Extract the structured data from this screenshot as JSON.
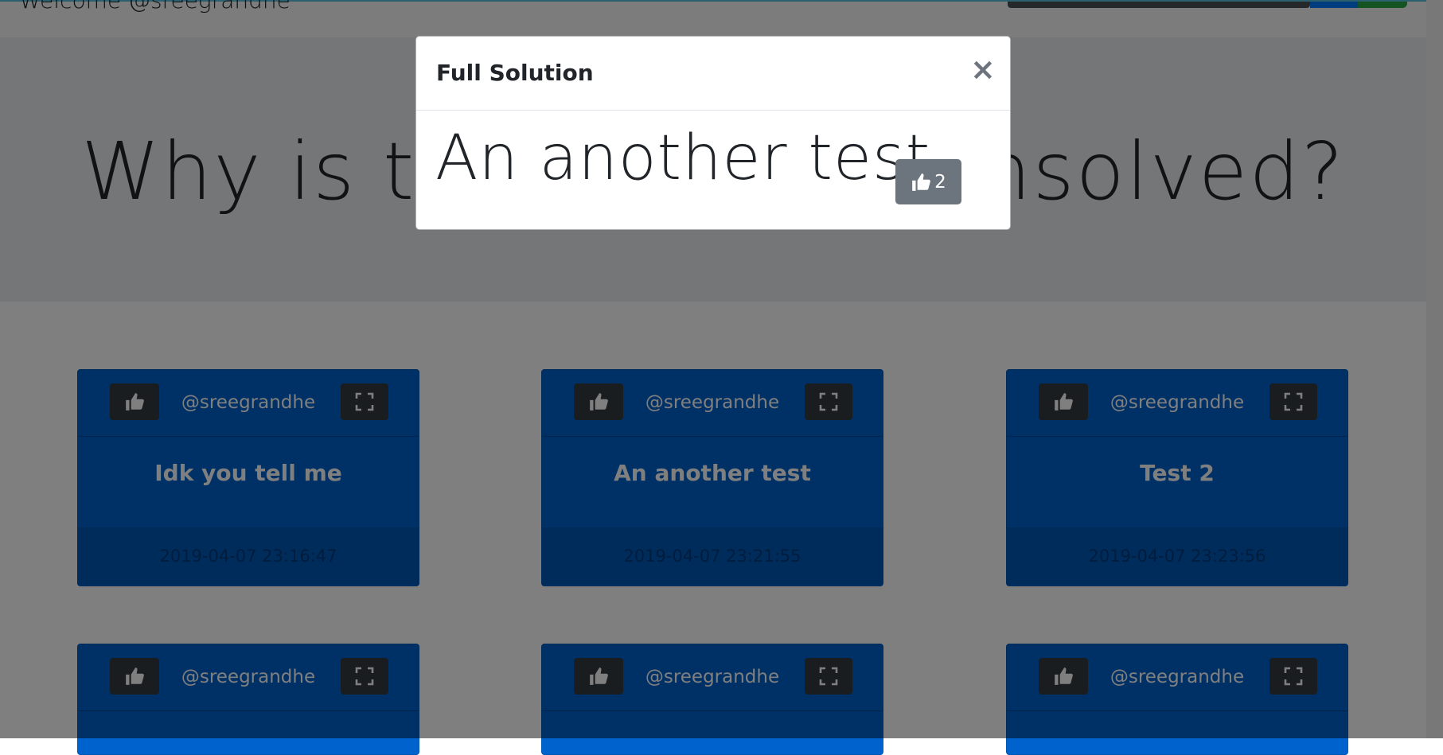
{
  "nav": {
    "welcome": "Welcome @sreegrandhe"
  },
  "question": {
    "text": "Why is this problem unsolved?"
  },
  "cards": [
    {
      "author": "@sreegrandhe",
      "title": "Idk you tell me",
      "date": "2019-04-07 23:16:47"
    },
    {
      "author": "@sreegrandhe",
      "title": "An another test",
      "date": "2019-04-07 23:21:55"
    },
    {
      "author": "@sreegrandhe",
      "title": "Test 2",
      "date": "2019-04-07 23:23:56"
    },
    {
      "author": "@sreegrandhe",
      "title": "",
      "date": ""
    },
    {
      "author": "@sreegrandhe",
      "title": "",
      "date": ""
    },
    {
      "author": "@sreegrandhe",
      "title": "",
      "date": ""
    }
  ],
  "icons": {
    "like": "thumbs-up-icon",
    "expand": "expand-icon",
    "close": "close-icon"
  },
  "modal": {
    "title": "Full Solution",
    "close_label": "×",
    "body": "An another test",
    "like_count": "2"
  },
  "colors": {
    "card_bg": "#0062cc",
    "icon_button_bg": "#343a40",
    "badge_bg": "#6c757d",
    "backdrop": "rgba(0,0,0,0.5)"
  }
}
